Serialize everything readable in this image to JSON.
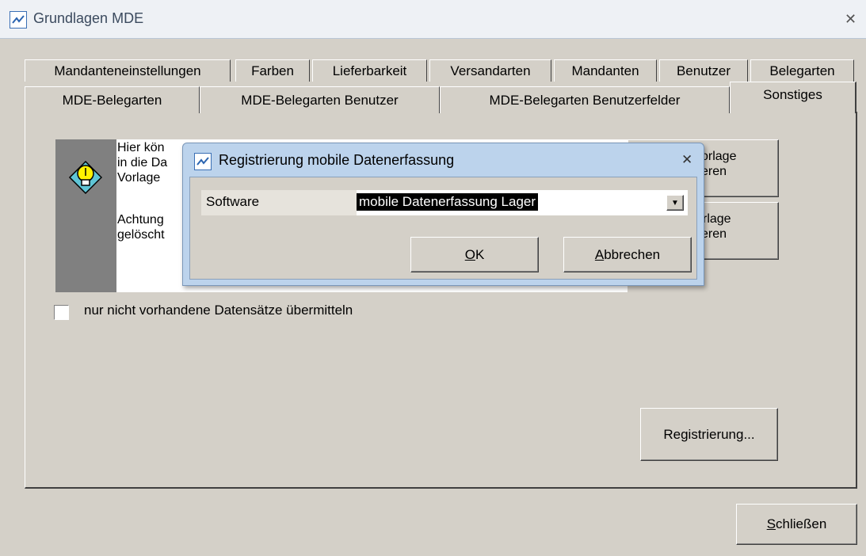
{
  "window": {
    "title": "Grundlagen MDE"
  },
  "tabs_row1": [
    "Mandanteneinstellungen",
    "Farben",
    "Lieferbarkeit",
    "Versandarten",
    "Mandanten",
    "Benutzer",
    "Belegarten"
  ],
  "tabs_row2": [
    "MDE-Belegarten",
    "MDE-Belegarten Benutzer",
    "MDE-Belegarten Benutzerfelder",
    "Sonstiges"
  ],
  "info": {
    "line1": "Hier kön",
    "line2": "in die Da",
    "line3": "Vorlage",
    "line4": "Achtung",
    "line5": "gelöscht"
  },
  "side_buttons": [
    {
      "line1": "orlage",
      "line2": "eren"
    },
    {
      "line1": "rlage",
      "line2": "eren"
    }
  ],
  "checkbox": {
    "label": "nur nicht vorhandene Datensätze übermitteln",
    "checked": false
  },
  "registrierung_button": "Registrierung...",
  "close_button": {
    "mnemonic": "S",
    "rest": "chließen"
  },
  "dialog": {
    "title": "Registrierung mobile Datenerfassung",
    "software_label": "Software",
    "software_value": "mobile Datenerfassung Lager",
    "ok": {
      "mnemonic": "O",
      "rest": "K"
    },
    "cancel": {
      "mnemonic": "A",
      "rest": "bbrechen"
    }
  }
}
